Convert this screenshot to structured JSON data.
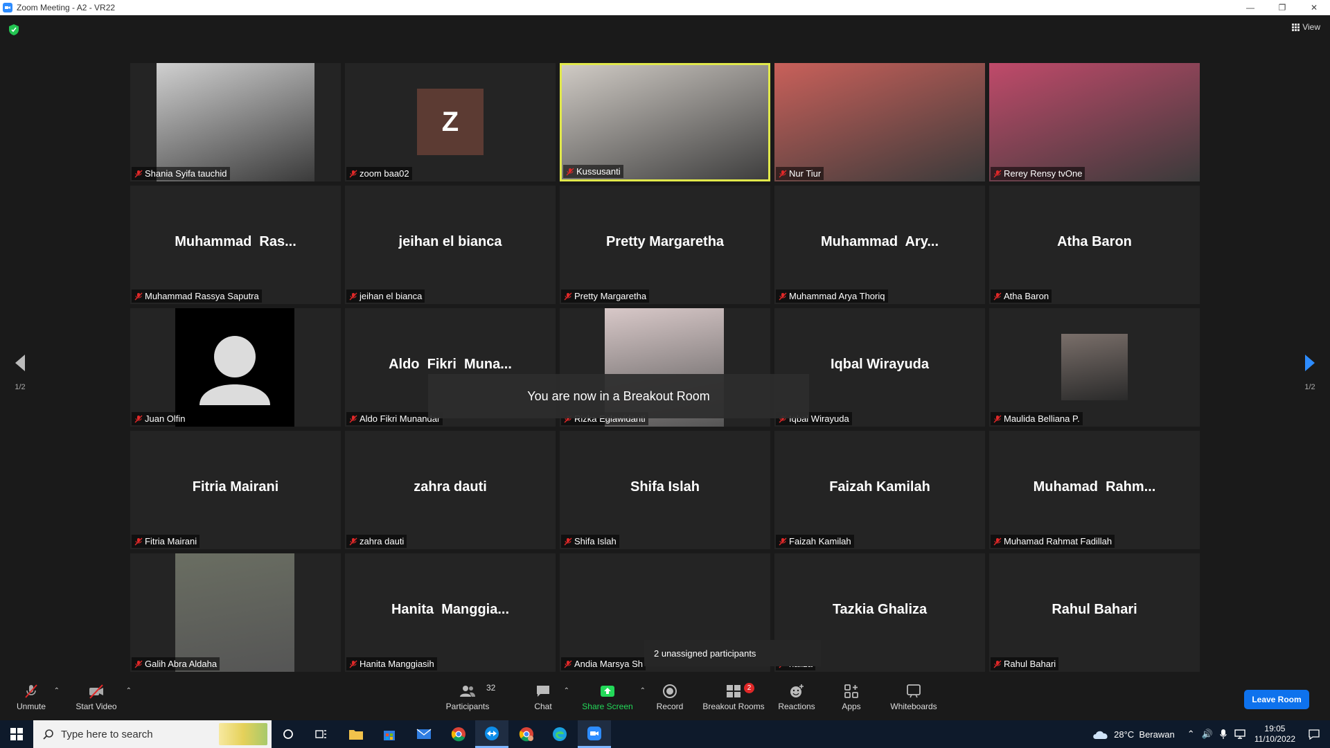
{
  "window": {
    "title": "Zoom Meeting - A2 - VR22"
  },
  "topbar": {
    "view_label": "View"
  },
  "tiles": [
    {
      "row": 0,
      "col": 0,
      "type": "video",
      "label": "Shania Syifa tauchid",
      "bg": "#d0d0d0"
    },
    {
      "row": 0,
      "col": 1,
      "type": "initial",
      "initial": "Z",
      "label": "zoom baa02"
    },
    {
      "row": 0,
      "col": 2,
      "type": "video",
      "label": "Kussusanti",
      "active": true,
      "bg": "#cfcac4"
    },
    {
      "row": 0,
      "col": 3,
      "type": "video",
      "label": "Nur Tiur",
      "bg": "#c9605a"
    },
    {
      "row": 0,
      "col": 4,
      "type": "video",
      "label": "Rerey Rensy tvOne",
      "bg": "#c04a6a"
    },
    {
      "row": 1,
      "col": 0,
      "type": "name",
      "display": "Muhammad  Ras...",
      "label": "Muhammad Rassya Saputra"
    },
    {
      "row": 1,
      "col": 1,
      "type": "name",
      "display": "jeihan el bianca",
      "label": "jeihan el bianca"
    },
    {
      "row": 1,
      "col": 2,
      "type": "name",
      "display": "Pretty Margaretha",
      "label": "Pretty Margaretha"
    },
    {
      "row": 1,
      "col": 3,
      "type": "name",
      "display": "Muhammad  Ary...",
      "label": "Muhammad Arya Thoriq"
    },
    {
      "row": 1,
      "col": 4,
      "type": "name",
      "display": "Atha Baron",
      "label": "Atha Baron"
    },
    {
      "row": 2,
      "col": 0,
      "type": "placeholder",
      "label": "Juan Olfin"
    },
    {
      "row": 2,
      "col": 1,
      "type": "name",
      "display": "Aldo  Fikri  Muna...",
      "label": "Aldo Fikri Munandar"
    },
    {
      "row": 2,
      "col": 2,
      "type": "photo",
      "label": "Rizka Eglawidanti",
      "bg": "#d8c8c8"
    },
    {
      "row": 2,
      "col": 3,
      "type": "name",
      "display": "Iqbal Wirayuda",
      "label": "Iqbal Wirayuda"
    },
    {
      "row": 2,
      "col": 4,
      "type": "smallphoto",
      "label": "Maulida Belliana P.",
      "bg": "#7a6f6a"
    },
    {
      "row": 3,
      "col": 0,
      "type": "name",
      "display": "Fitria Mairani",
      "label": "Fitria Mairani"
    },
    {
      "row": 3,
      "col": 1,
      "type": "name",
      "display": "zahra dauti",
      "label": "zahra dauti"
    },
    {
      "row": 3,
      "col": 2,
      "type": "name",
      "display": "Shifa Islah",
      "label": "Shifa Islah"
    },
    {
      "row": 3,
      "col": 3,
      "type": "name",
      "display": "Faizah Kamilah",
      "label": "Faizah Kamilah"
    },
    {
      "row": 3,
      "col": 4,
      "type": "name",
      "display": "Muhamad  Rahm...",
      "label": "Muhamad Rahmat Fadillah"
    },
    {
      "row": 4,
      "col": 0,
      "type": "photo",
      "label": "Galih Abra Aldaha",
      "bg": "#6a6e62"
    },
    {
      "row": 4,
      "col": 1,
      "type": "name",
      "display": "Hanita  Manggia...",
      "label": "Hanita Manggiasih"
    },
    {
      "row": 4,
      "col": 2,
      "type": "name",
      "display": "",
      "label": "Andia Marsya Sh"
    },
    {
      "row": 4,
      "col": 3,
      "type": "name",
      "display": "Tazkia Ghaliza",
      "label": "haliza"
    },
    {
      "row": 4,
      "col": 4,
      "type": "name",
      "display": "Rahul Bahari",
      "label": "Rahul Bahari"
    }
  ],
  "pager": {
    "left": "1/2",
    "right": "1/2"
  },
  "toast": {
    "text": "You are now in a Breakout Room"
  },
  "unassigned": {
    "text": "2 unassigned participants"
  },
  "toolbar": {
    "unmute": "Unmute",
    "start_video": "Start Video",
    "participants": "Participants",
    "participants_count": "32",
    "chat": "Chat",
    "share_screen": "Share Screen",
    "record": "Record",
    "breakout_rooms": "Breakout Rooms",
    "breakout_badge": "2",
    "reactions": "Reactions",
    "apps": "Apps",
    "whiteboards": "Whiteboards",
    "leave": "Leave Room"
  },
  "taskbar": {
    "search_placeholder": "Type here to search",
    "weather": "28°C  Berawan",
    "time": "19:05",
    "date": "11/10/2022"
  },
  "colors": {
    "accent": "#0e72ed",
    "active_border": "#e1e84b",
    "share_green": "#23d959",
    "mute_red": "#e02828"
  }
}
